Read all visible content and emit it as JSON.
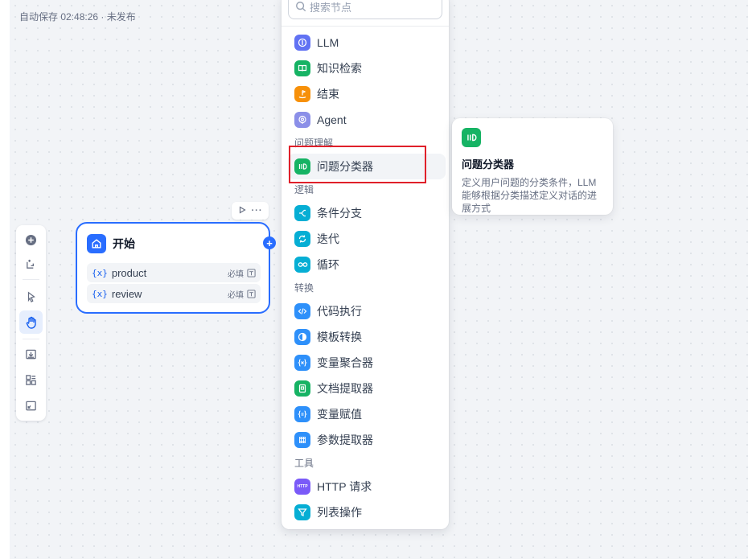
{
  "status": {
    "autosave": "自动保存 02:48:26 · 未发布"
  },
  "start_node": {
    "title": "开始",
    "variables": [
      {
        "icon": "{x}",
        "name": "product",
        "required": "必填"
      },
      {
        "icon": "{x}",
        "name": "review",
        "required": "必填"
      }
    ]
  },
  "search": {
    "placeholder": "搜索节点"
  },
  "blocks": {
    "llm": "LLM",
    "knowledge": "知识检索",
    "end": "结束",
    "agent": "Agent",
    "cat_understand": "问题理解",
    "classifier": "问题分类器",
    "cat_logic": "逻辑",
    "if_else": "条件分支",
    "iteration": "迭代",
    "loop": "循环",
    "cat_transform": "转换",
    "code": "代码执行",
    "template": "模板转换",
    "aggregator": "变量聚合器",
    "doc_extractor": "文档提取器",
    "assigner": "变量赋值",
    "param_extractor": "参数提取器",
    "cat_tools": "工具",
    "http": "HTTP 请求",
    "list_op": "列表操作"
  },
  "tooltip": {
    "title": "问题分类器",
    "description": "定义用户问题的分类条件，LLM 能够根据分类描述定义对话的进展方式"
  },
  "icon_labels": {
    "http": "HTTP"
  },
  "colors": {
    "primary": "#296dff",
    "llm": "#6172f3",
    "knowledge": "#16b364",
    "end": "#f79009",
    "agent": "#8b8fe8",
    "classifier": "#16b364",
    "logic": "#06aed4",
    "code": "#2e90fa",
    "doc": "#16b364",
    "http": "#7a5af8",
    "highlight": "#e0202a"
  }
}
